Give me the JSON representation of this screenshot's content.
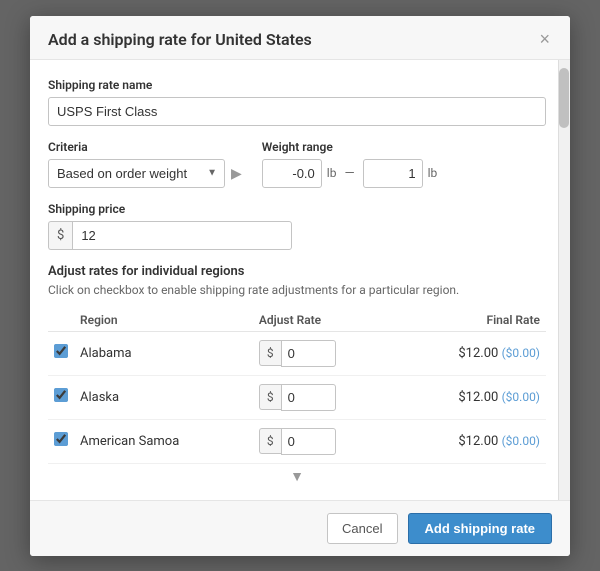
{
  "modal": {
    "title_prefix": "Add a shipping rate ",
    "title_for": "for United States",
    "close_label": "×",
    "shipping_rate_name_label": "Shipping rate name",
    "shipping_rate_name_value": "USPS First Class",
    "criteria_label": "Criteria",
    "criteria_value": "Based on order weight",
    "weight_range_label": "Weight range",
    "weight_min": "-0.0",
    "weight_min_unit": "lb",
    "weight_dash": "—",
    "weight_max": "1",
    "weight_max_unit": "lb",
    "shipping_price_label": "Shipping price",
    "shipping_price_prefix": "$",
    "shipping_price_value": "12",
    "adjust_section_title": "Adjust rates for individual regions",
    "adjust_section_hint": "Click on checkbox to enable shipping rate adjustments for a particular region.",
    "table_headers": {
      "region": "Region",
      "adjust_rate": "Adjust Rate",
      "final_rate": "Final Rate"
    },
    "regions": [
      {
        "name": "Alabama",
        "checked": true,
        "adjust_value": "0",
        "final_rate": "$12.00",
        "adjusted_diff": "($0.00)"
      },
      {
        "name": "Alaska",
        "checked": true,
        "adjust_value": "0",
        "final_rate": "$12.00",
        "adjusted_diff": "($0.00)"
      },
      {
        "name": "American Samoa",
        "checked": true,
        "adjust_value": "0",
        "final_rate": "$12.00",
        "adjusted_diff": "($0.00)"
      }
    ],
    "footer": {
      "cancel_label": "Cancel",
      "add_label": "Add shipping rate"
    }
  }
}
